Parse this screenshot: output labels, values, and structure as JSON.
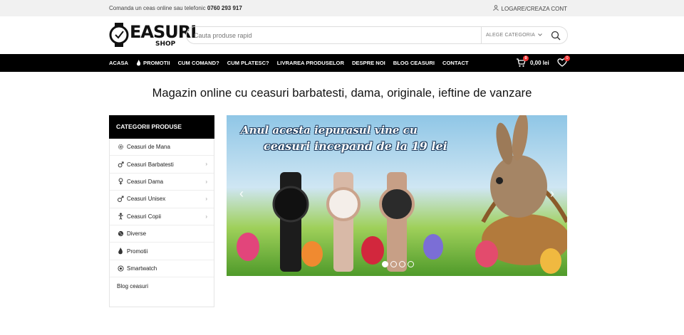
{
  "topbar": {
    "phone_text": "Comanda un ceas online sau telefonic",
    "phone_number": "0760 293 917",
    "login": "LOGARE/CREAZA CONT"
  },
  "logo": {
    "wordmark": "EASURI",
    "sub": "SHOP"
  },
  "search": {
    "placeholder": "Cauta produse rapid",
    "category": "ALEGE CATEGORIA"
  },
  "nav": {
    "items": [
      "ACASA",
      "PROMOTII",
      "CUM COMAND?",
      "CUM PLATESC?",
      "LIVRAREA PRODUSELOR",
      "DESPRE NOI",
      "BLOG CEASURI",
      "CONTACT"
    ],
    "cart_total": "0,00 lei",
    "cart_count": "0",
    "wishlist_count": "0"
  },
  "headline": "Magazin online cu ceasuri barbatesti, dama, originale, ieftine de vanzare",
  "sidebar": {
    "title": "CATEGORII PRODUSE",
    "items": [
      {
        "label": "Ceasuri de Mana",
        "icon": "gear-icon"
      },
      {
        "label": "Ceasuri Barbatesti",
        "icon": "male-icon"
      },
      {
        "label": "Ceasuri Dama",
        "icon": "female-icon"
      },
      {
        "label": "Ceasuri Unisex",
        "icon": "unisex-icon"
      },
      {
        "label": "Ceasuri Copii",
        "icon": "child-icon"
      },
      {
        "label": "Diverse",
        "icon": "globe-icon"
      },
      {
        "label": "Promotii",
        "icon": "flame-icon"
      },
      {
        "label": "Smartwatch",
        "icon": "ball-icon"
      },
      {
        "label": "Blog ceasuri",
        "icon": ""
      }
    ]
  },
  "banner": {
    "line1": "Anul acesta iepurasul vine cu",
    "line2": "ceasuri incepand de la 19 lei",
    "slides": 4,
    "active": 1
  },
  "colors": {
    "nav_bg": "#000000",
    "badge": "#e33333",
    "topbar_bg": "#f1f1f1"
  }
}
